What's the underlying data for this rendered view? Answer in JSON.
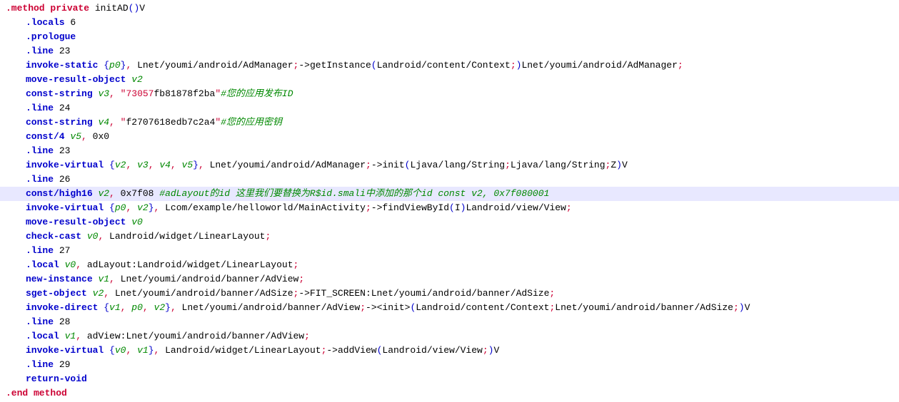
{
  "lines": [
    {
      "indent": 0,
      "hl": false,
      "parts": [
        {
          "cls": "kw-red",
          "t": ".method"
        },
        {
          "cls": "txt-black",
          "t": " "
        },
        {
          "cls": "kw-red",
          "t": "private"
        },
        {
          "cls": "txt-black",
          "t": " initAD"
        },
        {
          "cls": "txt-blue",
          "t": "("
        },
        {
          "cls": "txt-blue",
          "t": ")"
        },
        {
          "cls": "txt-black",
          "t": "V"
        }
      ]
    },
    {
      "indent": 1,
      "hl": false,
      "parts": [
        {
          "cls": "kw-blue",
          "t": ".locals"
        },
        {
          "cls": "txt-black",
          "t": " 6"
        }
      ]
    },
    {
      "indent": 1,
      "hl": false,
      "parts": [
        {
          "cls": "kw-blue",
          "t": ".prologue"
        }
      ]
    },
    {
      "indent": 1,
      "hl": false,
      "parts": [
        {
          "cls": "kw-blue",
          "t": ".line"
        },
        {
          "cls": "txt-black",
          "t": " 23"
        }
      ]
    },
    {
      "indent": 1,
      "hl": false,
      "parts": [
        {
          "cls": "kw-blue",
          "t": "invoke-static"
        },
        {
          "cls": "txt-black",
          "t": " "
        },
        {
          "cls": "txt-blue",
          "t": "{"
        },
        {
          "cls": "txt-green-italic",
          "t": "p0"
        },
        {
          "cls": "txt-blue",
          "t": "}"
        },
        {
          "cls": "txt-red",
          "t": ","
        },
        {
          "cls": "txt-black",
          "t": " Lnet/youmi/android/AdManager"
        },
        {
          "cls": "txt-red",
          "t": ";"
        },
        {
          "cls": "txt-black",
          "t": "->getInstance"
        },
        {
          "cls": "txt-blue",
          "t": "("
        },
        {
          "cls": "txt-black",
          "t": "Landroid/content/Context"
        },
        {
          "cls": "txt-red",
          "t": ";"
        },
        {
          "cls": "txt-blue",
          "t": ")"
        },
        {
          "cls": "txt-black",
          "t": "Lnet/youmi/android/AdManager"
        },
        {
          "cls": "txt-red",
          "t": ";"
        }
      ]
    },
    {
      "indent": 1,
      "hl": false,
      "parts": [
        {
          "cls": "kw-blue",
          "t": "move-result-object"
        },
        {
          "cls": "txt-black",
          "t": " "
        },
        {
          "cls": "txt-green-italic",
          "t": "v2"
        }
      ]
    },
    {
      "indent": 1,
      "hl": false,
      "parts": [
        {
          "cls": "kw-blue",
          "t": "const-string"
        },
        {
          "cls": "txt-black",
          "t": " "
        },
        {
          "cls": "txt-green-italic",
          "t": "v3"
        },
        {
          "cls": "txt-red",
          "t": ","
        },
        {
          "cls": "txt-black",
          "t": " "
        },
        {
          "cls": "txt-red",
          "t": "\"73057"
        },
        {
          "cls": "txt-black",
          "t": "fb81878f2ba"
        },
        {
          "cls": "txt-red",
          "t": "\""
        },
        {
          "cls": "txt-green-italic",
          "t": "#您的应用发布ID"
        }
      ]
    },
    {
      "indent": 1,
      "hl": false,
      "parts": [
        {
          "cls": "kw-blue",
          "t": ".line"
        },
        {
          "cls": "txt-black",
          "t": " 24"
        }
      ]
    },
    {
      "indent": 1,
      "hl": false,
      "parts": [
        {
          "cls": "kw-blue",
          "t": "const-string"
        },
        {
          "cls": "txt-black",
          "t": " "
        },
        {
          "cls": "txt-green-italic",
          "t": "v4"
        },
        {
          "cls": "txt-red",
          "t": ","
        },
        {
          "cls": "txt-black",
          "t": " "
        },
        {
          "cls": "txt-red",
          "t": "\""
        },
        {
          "cls": "txt-black",
          "t": "f2707618edb7c2a4"
        },
        {
          "cls": "txt-red",
          "t": "\""
        },
        {
          "cls": "txt-green-italic",
          "t": "#您的应用密钥"
        }
      ]
    },
    {
      "indent": 1,
      "hl": false,
      "parts": [
        {
          "cls": "kw-blue",
          "t": "const/4"
        },
        {
          "cls": "txt-black",
          "t": " "
        },
        {
          "cls": "txt-green-italic",
          "t": "v5"
        },
        {
          "cls": "txt-red",
          "t": ","
        },
        {
          "cls": "txt-black",
          "t": " 0x0"
        }
      ]
    },
    {
      "indent": 1,
      "hl": false,
      "parts": [
        {
          "cls": "kw-blue",
          "t": ".line"
        },
        {
          "cls": "txt-black",
          "t": " 23"
        }
      ]
    },
    {
      "indent": 1,
      "hl": false,
      "parts": [
        {
          "cls": "kw-blue",
          "t": "invoke-virtual"
        },
        {
          "cls": "txt-black",
          "t": " "
        },
        {
          "cls": "txt-blue",
          "t": "{"
        },
        {
          "cls": "txt-green-italic",
          "t": "v2"
        },
        {
          "cls": "txt-red",
          "t": ","
        },
        {
          "cls": "txt-black",
          "t": " "
        },
        {
          "cls": "txt-green-italic",
          "t": "v3"
        },
        {
          "cls": "txt-red",
          "t": ","
        },
        {
          "cls": "txt-black",
          "t": " "
        },
        {
          "cls": "txt-green-italic",
          "t": "v4"
        },
        {
          "cls": "txt-red",
          "t": ","
        },
        {
          "cls": "txt-black",
          "t": " "
        },
        {
          "cls": "txt-green-italic",
          "t": "v5"
        },
        {
          "cls": "txt-blue",
          "t": "}"
        },
        {
          "cls": "txt-red",
          "t": ","
        },
        {
          "cls": "txt-black",
          "t": " Lnet/youmi/android/AdManager"
        },
        {
          "cls": "txt-red",
          "t": ";"
        },
        {
          "cls": "txt-black",
          "t": "->init"
        },
        {
          "cls": "txt-blue",
          "t": "("
        },
        {
          "cls": "txt-black",
          "t": "Ljava/lang/String"
        },
        {
          "cls": "txt-red",
          "t": ";"
        },
        {
          "cls": "txt-black",
          "t": "Ljava/lang/String"
        },
        {
          "cls": "txt-red",
          "t": ";"
        },
        {
          "cls": "txt-black",
          "t": "Z"
        },
        {
          "cls": "txt-blue",
          "t": ")"
        },
        {
          "cls": "txt-black",
          "t": "V"
        }
      ]
    },
    {
      "indent": 1,
      "hl": false,
      "parts": [
        {
          "cls": "kw-blue",
          "t": ".line"
        },
        {
          "cls": "txt-black",
          "t": " 26"
        }
      ]
    },
    {
      "indent": 1,
      "hl": true,
      "parts": [
        {
          "cls": "kw-blue",
          "t": "const/high16"
        },
        {
          "cls": "txt-black",
          "t": " "
        },
        {
          "cls": "txt-green-italic",
          "t": "v2"
        },
        {
          "cls": "txt-red",
          "t": ","
        },
        {
          "cls": "txt-black",
          "t": " 0x7f08 "
        },
        {
          "cls": "txt-green-italic",
          "t": "#adLayout的id 这里我们要替换为R$id.smali中添加的那个id  const v2, 0x7f080001"
        }
      ]
    },
    {
      "indent": 1,
      "hl": false,
      "parts": [
        {
          "cls": "kw-blue",
          "t": "invoke-virtual"
        },
        {
          "cls": "txt-black",
          "t": " "
        },
        {
          "cls": "txt-blue",
          "t": "{"
        },
        {
          "cls": "txt-green-italic",
          "t": "p0"
        },
        {
          "cls": "txt-red",
          "t": ","
        },
        {
          "cls": "txt-black",
          "t": " "
        },
        {
          "cls": "txt-green-italic",
          "t": "v2"
        },
        {
          "cls": "txt-blue",
          "t": "}"
        },
        {
          "cls": "txt-red",
          "t": ","
        },
        {
          "cls": "txt-black",
          "t": " Lcom/example/helloworld/MainActivity"
        },
        {
          "cls": "txt-red",
          "t": ";"
        },
        {
          "cls": "txt-black",
          "t": "->findViewById"
        },
        {
          "cls": "txt-blue",
          "t": "("
        },
        {
          "cls": "txt-black",
          "t": "I"
        },
        {
          "cls": "txt-blue",
          "t": ")"
        },
        {
          "cls": "txt-black",
          "t": "Landroid/view/View"
        },
        {
          "cls": "txt-red",
          "t": ";"
        }
      ]
    },
    {
      "indent": 1,
      "hl": false,
      "parts": [
        {
          "cls": "kw-blue",
          "t": "move-result-object"
        },
        {
          "cls": "txt-black",
          "t": " "
        },
        {
          "cls": "txt-green-italic",
          "t": "v0"
        }
      ]
    },
    {
      "indent": 1,
      "hl": false,
      "parts": [
        {
          "cls": "kw-blue",
          "t": "check-cast"
        },
        {
          "cls": "txt-black",
          "t": " "
        },
        {
          "cls": "txt-green-italic",
          "t": "v0"
        },
        {
          "cls": "txt-red",
          "t": ","
        },
        {
          "cls": "txt-black",
          "t": " Landroid/widget/LinearLayout"
        },
        {
          "cls": "txt-red",
          "t": ";"
        }
      ]
    },
    {
      "indent": 1,
      "hl": false,
      "parts": [
        {
          "cls": "kw-blue",
          "t": ".line"
        },
        {
          "cls": "txt-black",
          "t": " 27"
        }
      ]
    },
    {
      "indent": 1,
      "hl": false,
      "parts": [
        {
          "cls": "kw-blue",
          "t": ".local"
        },
        {
          "cls": "txt-black",
          "t": " "
        },
        {
          "cls": "txt-green-italic",
          "t": "v0"
        },
        {
          "cls": "txt-red",
          "t": ","
        },
        {
          "cls": "txt-black",
          "t": " adLayout:Landroid/widget/LinearLayout"
        },
        {
          "cls": "txt-red",
          "t": ";"
        }
      ]
    },
    {
      "indent": 1,
      "hl": false,
      "parts": [
        {
          "cls": "kw-blue",
          "t": "new-instance"
        },
        {
          "cls": "txt-black",
          "t": " "
        },
        {
          "cls": "txt-green-italic",
          "t": "v1"
        },
        {
          "cls": "txt-red",
          "t": ","
        },
        {
          "cls": "txt-black",
          "t": " Lnet/youmi/android/banner/AdView"
        },
        {
          "cls": "txt-red",
          "t": ";"
        }
      ]
    },
    {
      "indent": 1,
      "hl": false,
      "parts": [
        {
          "cls": "kw-blue",
          "t": "sget-object"
        },
        {
          "cls": "txt-black",
          "t": " "
        },
        {
          "cls": "txt-green-italic",
          "t": "v2"
        },
        {
          "cls": "txt-red",
          "t": ","
        },
        {
          "cls": "txt-black",
          "t": " Lnet/youmi/android/banner/AdSize"
        },
        {
          "cls": "txt-red",
          "t": ";"
        },
        {
          "cls": "txt-black",
          "t": "->FIT_SCREEN:Lnet/youmi/android/banner/AdSize"
        },
        {
          "cls": "txt-red",
          "t": ";"
        }
      ]
    },
    {
      "indent": 1,
      "hl": false,
      "parts": [
        {
          "cls": "kw-blue",
          "t": "invoke-direct"
        },
        {
          "cls": "txt-black",
          "t": " "
        },
        {
          "cls": "txt-blue",
          "t": "{"
        },
        {
          "cls": "txt-green-italic",
          "t": "v1"
        },
        {
          "cls": "txt-red",
          "t": ","
        },
        {
          "cls": "txt-black",
          "t": " "
        },
        {
          "cls": "txt-green-italic",
          "t": "p0"
        },
        {
          "cls": "txt-red",
          "t": ","
        },
        {
          "cls": "txt-black",
          "t": " "
        },
        {
          "cls": "txt-green-italic",
          "t": "v2"
        },
        {
          "cls": "txt-blue",
          "t": "}"
        },
        {
          "cls": "txt-red",
          "t": ","
        },
        {
          "cls": "txt-black",
          "t": " Lnet/youmi/android/banner/AdView"
        },
        {
          "cls": "txt-red",
          "t": ";"
        },
        {
          "cls": "txt-black",
          "t": "-><init>"
        },
        {
          "cls": "txt-blue",
          "t": "("
        },
        {
          "cls": "txt-black",
          "t": "Landroid/content/Context"
        },
        {
          "cls": "txt-red",
          "t": ";"
        },
        {
          "cls": "txt-black",
          "t": "Lnet/youmi/android/banner/AdSize"
        },
        {
          "cls": "txt-red",
          "t": ";"
        },
        {
          "cls": "txt-blue",
          "t": ")"
        },
        {
          "cls": "txt-black",
          "t": "V"
        }
      ]
    },
    {
      "indent": 1,
      "hl": false,
      "parts": [
        {
          "cls": "kw-blue",
          "t": ".line"
        },
        {
          "cls": "txt-black",
          "t": " 28"
        }
      ]
    },
    {
      "indent": 1,
      "hl": false,
      "parts": [
        {
          "cls": "kw-blue",
          "t": ".local"
        },
        {
          "cls": "txt-black",
          "t": " "
        },
        {
          "cls": "txt-green-italic",
          "t": "v1"
        },
        {
          "cls": "txt-red",
          "t": ","
        },
        {
          "cls": "txt-black",
          "t": " adView:Lnet/youmi/android/banner/AdView"
        },
        {
          "cls": "txt-red",
          "t": ";"
        }
      ]
    },
    {
      "indent": 1,
      "hl": false,
      "parts": [
        {
          "cls": "kw-blue",
          "t": "invoke-virtual"
        },
        {
          "cls": "txt-black",
          "t": " "
        },
        {
          "cls": "txt-blue",
          "t": "{"
        },
        {
          "cls": "txt-green-italic",
          "t": "v0"
        },
        {
          "cls": "txt-red",
          "t": ","
        },
        {
          "cls": "txt-black",
          "t": " "
        },
        {
          "cls": "txt-green-italic",
          "t": "v1"
        },
        {
          "cls": "txt-blue",
          "t": "}"
        },
        {
          "cls": "txt-red",
          "t": ","
        },
        {
          "cls": "txt-black",
          "t": " Landroid/widget/LinearLayout"
        },
        {
          "cls": "txt-red",
          "t": ";"
        },
        {
          "cls": "txt-black",
          "t": "->addView"
        },
        {
          "cls": "txt-blue",
          "t": "("
        },
        {
          "cls": "txt-black",
          "t": "Landroid/view/View"
        },
        {
          "cls": "txt-red",
          "t": ";"
        },
        {
          "cls": "txt-blue",
          "t": ")"
        },
        {
          "cls": "txt-black",
          "t": "V"
        }
      ]
    },
    {
      "indent": 1,
      "hl": false,
      "parts": [
        {
          "cls": "kw-blue",
          "t": ".line"
        },
        {
          "cls": "txt-black",
          "t": " 29"
        }
      ]
    },
    {
      "indent": 1,
      "hl": false,
      "parts": [
        {
          "cls": "kw-blue",
          "t": "return-void"
        }
      ]
    },
    {
      "indent": 0,
      "hl": false,
      "parts": [
        {
          "cls": "kw-red",
          "t": ".end method"
        }
      ]
    }
  ]
}
